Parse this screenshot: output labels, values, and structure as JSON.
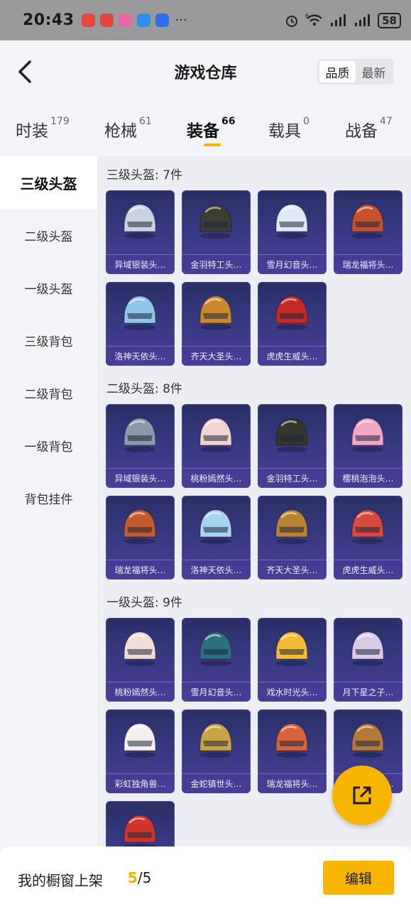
{
  "status_bar": {
    "time": "20:43",
    "network_label": "6",
    "battery": "58"
  },
  "header": {
    "title": "游戏仓库",
    "sort_options": [
      "品质",
      "最新"
    ]
  },
  "tabs": [
    {
      "label": "时装",
      "count": "179"
    },
    {
      "label": "枪械",
      "count": "61"
    },
    {
      "label": "装备",
      "count": "66"
    },
    {
      "label": "载具",
      "count": "0"
    },
    {
      "label": "战备",
      "count": "47"
    }
  ],
  "sidebar": {
    "items": [
      "三级头盔",
      "二级头盔",
      "一级头盔",
      "三级背包",
      "二级背包",
      "一级背包",
      "背包挂件"
    ]
  },
  "sections": [
    {
      "title": "三级头盔: 7件",
      "items": [
        {
          "name": "异域银装头…",
          "color": "#c9d3e0"
        },
        {
          "name": "金羽特工头…",
          "color": "#3b3f32"
        },
        {
          "name": "雪月幻音头…",
          "color": "#dfe9f7"
        },
        {
          "name": "瑞龙福将头…",
          "color": "#c8502c"
        },
        {
          "name": "洛神天依头…",
          "color": "#8fc4ea"
        },
        {
          "name": "齐天大圣头…",
          "color": "#c9872e"
        },
        {
          "name": "虎虎生威头…",
          "color": "#c32a24"
        }
      ]
    },
    {
      "title": "二级头盔: 8件",
      "items": [
        {
          "name": "异域银装头…",
          "color": "#8a9aa8"
        },
        {
          "name": "桃粉嫣然头…",
          "color": "#f1d3cf"
        },
        {
          "name": "金羽特工头…",
          "color": "#34362b"
        },
        {
          "name": "樱桃泡泡头…",
          "color": "#f2a6c6"
        },
        {
          "name": "瑞龙福将头…",
          "color": "#c45b2d"
        },
        {
          "name": "洛神天依头…",
          "color": "#a9d4ef"
        },
        {
          "name": "齐天大圣头…",
          "color": "#b98331"
        },
        {
          "name": "虎虎生威头…",
          "color": "#d84a3c"
        }
      ]
    },
    {
      "title": "一级头盔: 9件",
      "items": [
        {
          "name": "桃粉嫣然头…",
          "color": "#f2dcd6"
        },
        {
          "name": "雪月幻音头…",
          "color": "#2d6f7c"
        },
        {
          "name": "戏水时光头…",
          "color": "#f2bb32"
        },
        {
          "name": "月下星之子…",
          "color": "#d9cbe8"
        },
        {
          "name": "彩虹独角兽…",
          "color": "#f5eef0"
        },
        {
          "name": "金蛇镇世头…",
          "color": "#c9a447"
        },
        {
          "name": "瑞龙福将头…",
          "color": "#d7633a"
        },
        {
          "name": "齐天大圣头…",
          "color": "#b57a3a"
        },
        {
          "name": "",
          "color": "#d0352c"
        }
      ]
    }
  ],
  "bottom_bar": {
    "shelf_label": "我的橱窗上架",
    "current": "5",
    "separator": "/",
    "max": "5",
    "edit_label": "编辑"
  },
  "colors": {
    "accent": "#f7b500",
    "card_bg": "#3a3a85"
  },
  "icons": {
    "back": "back-arrow-icon",
    "share": "share-out-icon"
  }
}
